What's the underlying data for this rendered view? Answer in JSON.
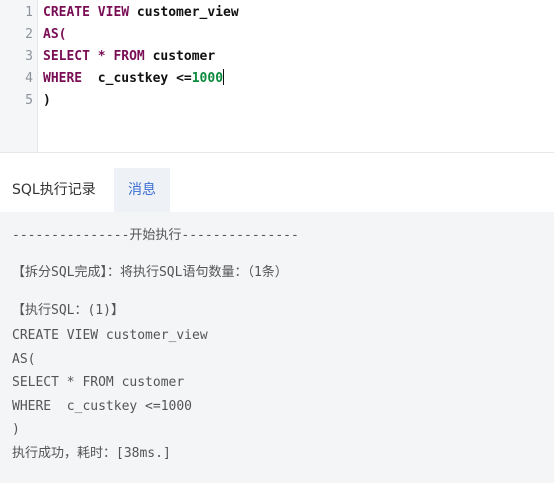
{
  "editor": {
    "line_numbers": [
      "1",
      "2",
      "3",
      "4",
      "5"
    ],
    "lines": [
      {
        "t1": "CREATE VIEW ",
        "t2": "customer_view"
      },
      {
        "t1": "AS("
      },
      {
        "t1": "SELECT * FROM ",
        "t2": "customer"
      },
      {
        "t1": "WHERE  ",
        "t2": "c_custkey <=",
        "t3": "1000"
      },
      {
        "t1": ")"
      }
    ]
  },
  "tabs": {
    "sql_log": "SQL执行记录",
    "messages": "消息"
  },
  "messages": {
    "start": "---------------开始执行---------------",
    "split_done": "【拆分SQL完成】：将执行SQL语句数量：（1条）",
    "exec_header": "【执行SQL：(1)】",
    "sql_lines": [
      "CREATE VIEW customer_view",
      "AS(",
      "SELECT * FROM customer",
      "WHERE  c_custkey <=1000",
      ")"
    ],
    "result": "执行成功，耗时：[38ms.]"
  }
}
